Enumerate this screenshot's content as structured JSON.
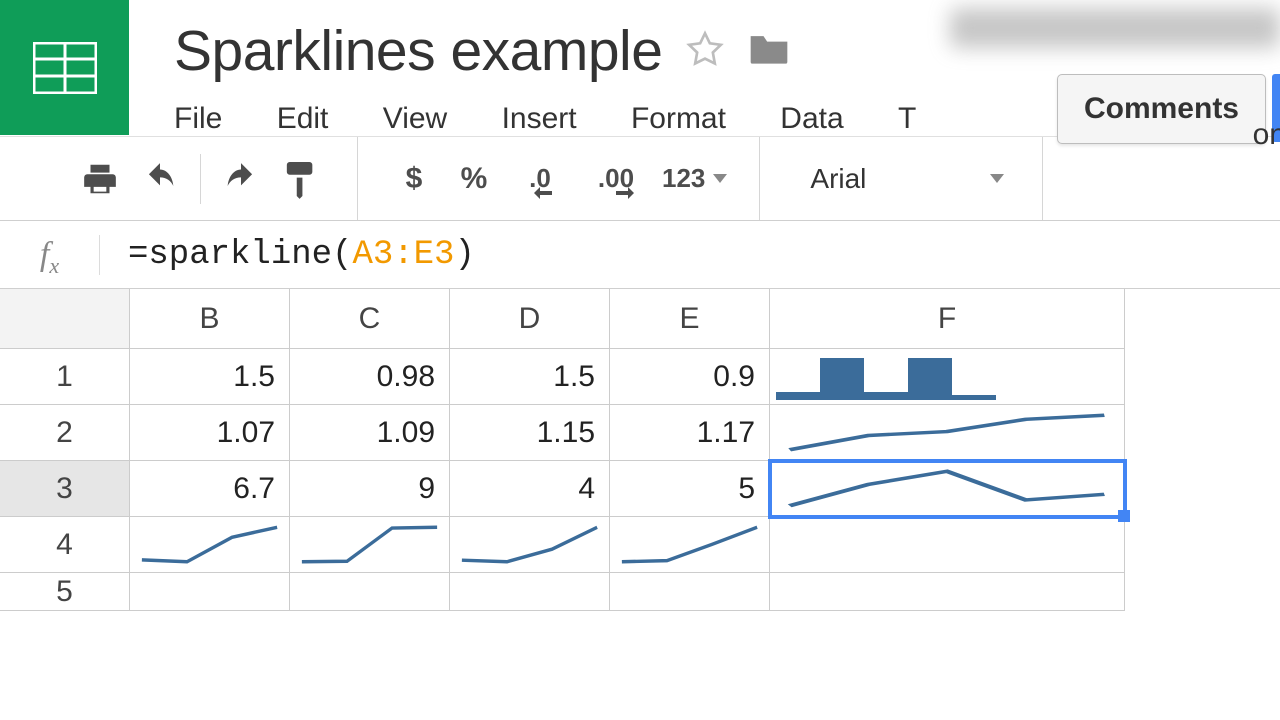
{
  "doc": {
    "title": "Sparklines example"
  },
  "menu": {
    "file": "File",
    "edit": "Edit",
    "view": "View",
    "insert": "Insert",
    "format": "Format",
    "data": "Data",
    "t_stub": "T",
    "on_stub": "on"
  },
  "header": {
    "comments_label": "Comments"
  },
  "toolbar": {
    "currency": "$",
    "percent": "%",
    "dec_dec": ".0",
    "inc_dec": ".00",
    "fmt123": "123",
    "font": "Arial"
  },
  "formula": {
    "prefix": "=sparkline(",
    "ref": "A3:E3",
    "suffix": ")"
  },
  "columns": [
    "B",
    "C",
    "D",
    "E",
    "F"
  ],
  "rows": [
    "1",
    "2",
    "3",
    "4",
    "5"
  ],
  "cells": {
    "r1": {
      "B": "1.5",
      "C": "0.98",
      "D": "1.5",
      "E": "0.9"
    },
    "r2": {
      "B": "1.07",
      "C": "1.09",
      "D": "1.15",
      "E": "1.17"
    },
    "r3": {
      "B": "6.7",
      "C": "9",
      "D": "4",
      "E": "5"
    }
  },
  "chart_data": [
    {
      "type": "bar",
      "location": "F1",
      "values": [
        0.18,
        1.0,
        0.18,
        1.0,
        0.12
      ]
    },
    {
      "type": "line",
      "location": "F2",
      "x": [
        0,
        1,
        2,
        3,
        4
      ],
      "values": [
        1.0,
        1.07,
        1.09,
        1.15,
        1.17
      ]
    },
    {
      "type": "line",
      "location": "F3",
      "x": [
        0,
        1,
        2,
        3,
        4
      ],
      "values": [
        3,
        6.7,
        9,
        4,
        5
      ]
    },
    {
      "type": "line",
      "location": "B4",
      "x": [
        0,
        1,
        2,
        3
      ],
      "values": [
        1.5,
        1.07,
        6.7,
        9
      ]
    },
    {
      "type": "line",
      "location": "C4",
      "x": [
        0,
        1,
        2,
        3
      ],
      "values": [
        0.98,
        1.09,
        9,
        9.2
      ]
    },
    {
      "type": "line",
      "location": "D4",
      "x": [
        0,
        1,
        2,
        3
      ],
      "values": [
        1.5,
        1.15,
        4,
        9
      ]
    },
    {
      "type": "line",
      "location": "E4",
      "x": [
        0,
        1,
        2,
        3
      ],
      "values": [
        0.9,
        1.17,
        5,
        9
      ]
    }
  ],
  "selection": {
    "cell": "F3"
  }
}
